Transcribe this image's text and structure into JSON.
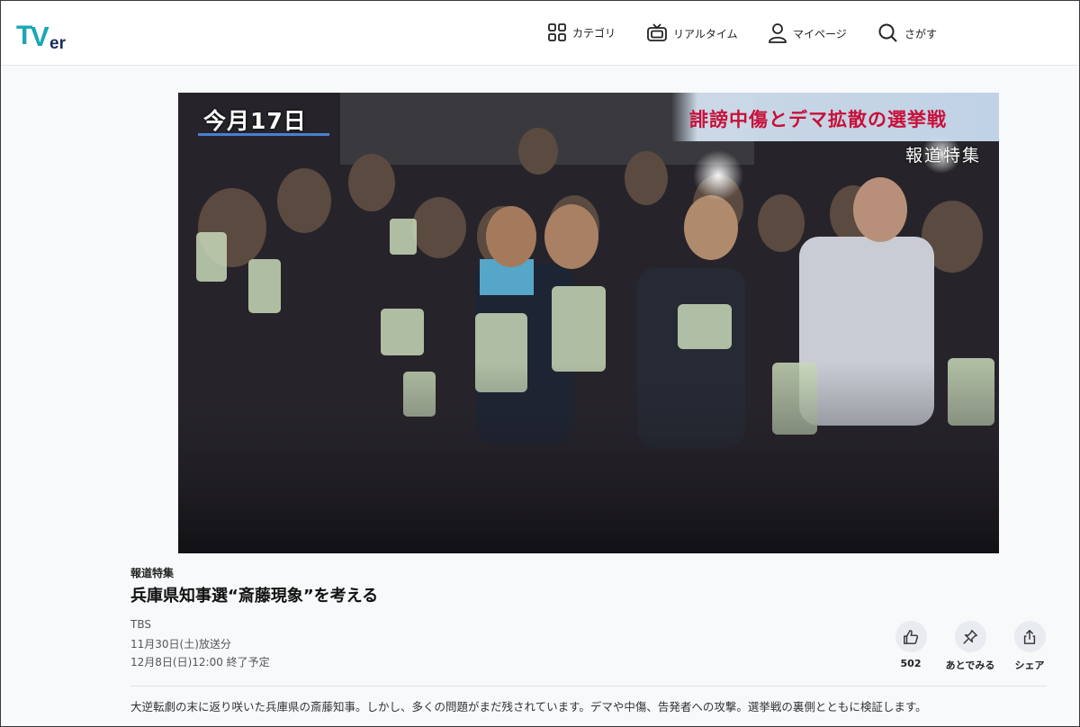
{
  "header": {
    "logo_text": "TVer",
    "nav": {
      "category": "カテゴリ",
      "realtime": "リアルタイム",
      "mypage": "マイページ",
      "search": "さがす"
    }
  },
  "video": {
    "date_caption": "今月17日",
    "headline_caption": "誹謗中傷とデマ拡散の選挙戦",
    "corner_tag": "報道特集"
  },
  "episode": {
    "series": "報道特集",
    "title": "兵庫県知事選“斎藤現象”を考える",
    "broadcaster": "TBS",
    "aired": "11月30日(土)放送分",
    "ends": "12月8日(日)12:00 終了予定",
    "description": "大逆転劇の末に返り咲いた兵庫県の斎藤知事。しかし、多くの問題がまだ残されています。デマや中傷、告発者への攻撃。選挙戦の裏側とともに検証します。"
  },
  "actions": {
    "like_count": "502",
    "watch_later": "あとでみる",
    "share": "シェア"
  },
  "colors": {
    "logo_teal": "#1aa6b7",
    "logo_navy": "#1a2d5a",
    "headline_red": "#c8103a"
  }
}
